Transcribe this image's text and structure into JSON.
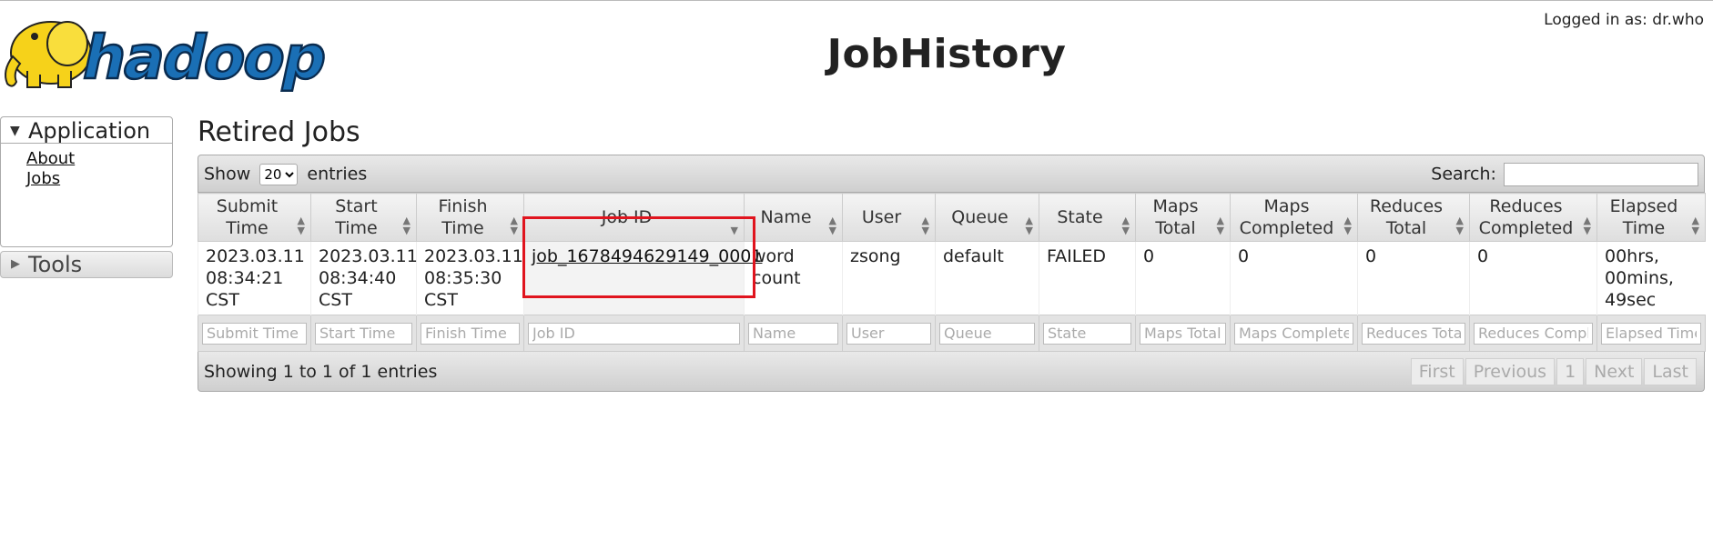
{
  "header": {
    "logo_text": "hadoop",
    "title": "JobHistory",
    "logged_in": "Logged in as: dr.who"
  },
  "sidebar": {
    "application": {
      "label": "Application",
      "links": [
        "About",
        "Jobs"
      ]
    },
    "tools": {
      "label": "Tools"
    }
  },
  "main": {
    "section_title": "Retired Jobs",
    "show_label": "Show",
    "entries_label": "entries",
    "page_size": "20",
    "page_size_options": [
      "20"
    ],
    "search_label": "Search:",
    "columns": [
      "Submit Time",
      "Start Time",
      "Finish Time",
      "Job ID",
      "Name",
      "User",
      "Queue",
      "State",
      "Maps Total",
      "Maps Completed",
      "Reduces Total",
      "Reduces Completed",
      "Elapsed Time"
    ],
    "rows": [
      {
        "submit_time": "2023.03.11 08:34:21 CST",
        "start_time": "2023.03.11 08:34:40 CST",
        "finish_time": "2023.03.11 08:35:30 CST",
        "job_id": "job_1678494629149_0001",
        "name": "word count",
        "user": "zsong",
        "queue": "default",
        "state": "FAILED",
        "maps_total": "0",
        "maps_completed": "0",
        "reduces_total": "0",
        "reduces_completed": "0",
        "elapsed_time": "00hrs, 00mins, 49sec"
      }
    ],
    "filters": [
      "Submit Time",
      "Start Time",
      "Finish Time",
      "Job ID",
      "Name",
      "User",
      "Queue",
      "State",
      "Maps Total",
      "Maps Completed",
      "Reduces Total",
      "Reduces Completed",
      "Elapsed Time"
    ],
    "info": "Showing 1 to 1 of 1 entries",
    "pager": [
      "First",
      "Previous",
      "1",
      "Next",
      "Last"
    ]
  },
  "colors": {
    "highlight": "#e0141e",
    "logo_blue": "#1a6fb5",
    "elephant_yellow": "#f6d21a"
  }
}
